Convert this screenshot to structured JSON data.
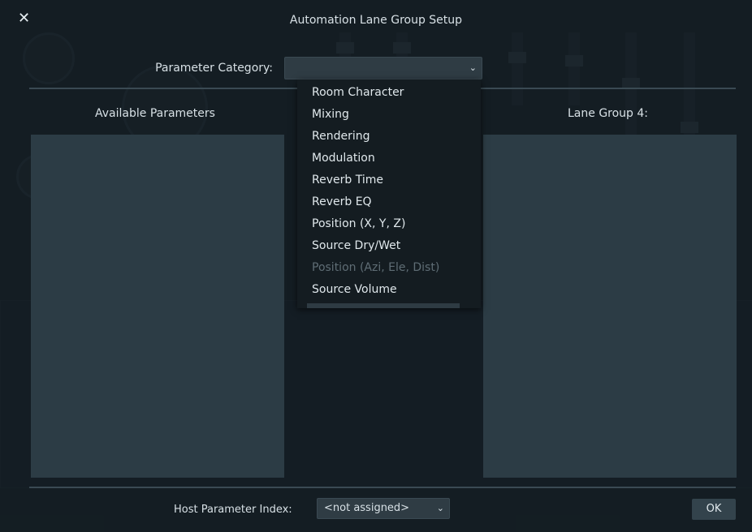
{
  "dialog": {
    "title": "Automation Lane Group Setup",
    "close_icon": "close-icon",
    "category_label": "Parameter Category:",
    "category_value": "",
    "available_label": "Available Parameters",
    "lane_group_label": "Lane Group 4:",
    "host_index_label": "Host Parameter Index:",
    "host_index_value": "<not assigned>",
    "ok_label": "OK"
  },
  "menu": {
    "items": [
      {
        "label": "Room Character",
        "enabled": true
      },
      {
        "label": "Mixing",
        "enabled": true
      },
      {
        "label": "Rendering",
        "enabled": true
      },
      {
        "label": "Modulation",
        "enabled": true
      },
      {
        "label": "Reverb Time",
        "enabled": true
      },
      {
        "label": "Reverb EQ",
        "enabled": true
      },
      {
        "label": "Position (X, Y, Z)",
        "enabled": true
      },
      {
        "label": "Source Dry/Wet",
        "enabled": true
      },
      {
        "label": "Position (Azi, Ele, Dist)",
        "enabled": false
      },
      {
        "label": "Source Volume",
        "enabled": true
      }
    ]
  },
  "colors": {
    "panel": "#2c3c45",
    "background": "#0f1519",
    "text": "#d7e0e5",
    "disabled_text": "#5f6d75"
  }
}
